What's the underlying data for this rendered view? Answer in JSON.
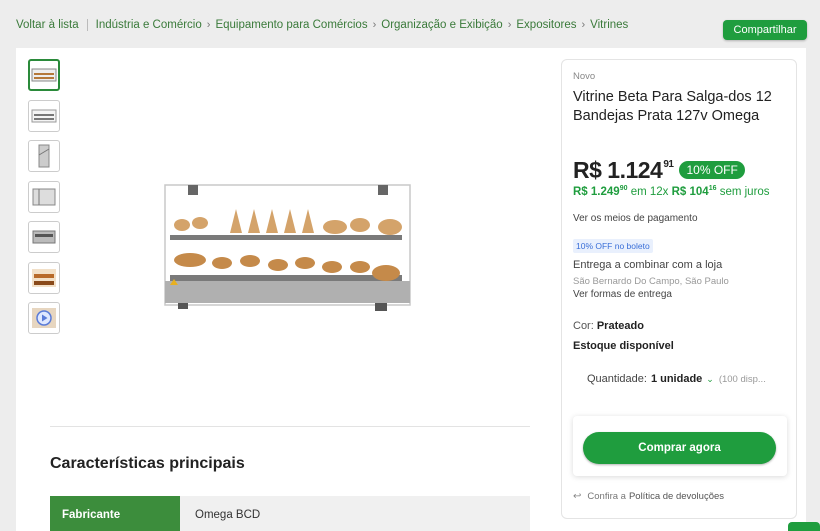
{
  "breadcrumb": {
    "back": "Voltar à lista",
    "items": [
      "Indústria e Comércio",
      "Equipamento para Comércios",
      "Organização e Exibição",
      "Expositores",
      "Vitrines"
    ]
  },
  "share_label": "Compartilhar",
  "thumbnails": [
    {
      "icon": "product-thumbnail-icon"
    },
    {
      "icon": "product-thumbnail-icon"
    },
    {
      "icon": "product-thumbnail-icon"
    },
    {
      "icon": "product-thumbnail-icon"
    },
    {
      "icon": "product-thumbnail-icon"
    },
    {
      "icon": "product-thumbnail-icon"
    },
    {
      "icon": "video-play-icon"
    }
  ],
  "features": {
    "title": "Características principais",
    "rows": [
      {
        "key": "Fabricante",
        "value": "Omega BCD"
      }
    ]
  },
  "product": {
    "condition": "Novo",
    "title": "Vitrine Beta Para Salga-dos 12 Bandejas Prata 127v Omega",
    "price_int": "R$ 1.124",
    "price_cents": "91",
    "discount": "10% OFF",
    "old_price_int": "R$ 1.249",
    "old_price_cents": "90",
    "installments_prefix": "em 12x",
    "installment_int": "R$ 104",
    "installment_cents": "16",
    "installments_suffix": "sem juros",
    "payment_link": "Ver os meios de pagamento",
    "boleto_badge": "10% OFF no boleto",
    "delivery": "Entrega a combinar com a loja",
    "location": "São Bernardo Do Campo, São Paulo",
    "delivery_link": "Ver formas de entrega",
    "color_label": "Cor:",
    "color_value": "Prateado",
    "stock": "Estoque disponível",
    "qty_label": "Quantidade:",
    "qty_value": "1 unidade",
    "qty_available": "(100 disp...",
    "buy_label": "Comprar agora",
    "returns_text": "Confira a",
    "returns_link": "Política de devoluções"
  },
  "colors": {
    "accent": "#1f9d3e",
    "breadcrumb": "#3a7a3a",
    "feature_key_bg": "#3c8d3c"
  }
}
